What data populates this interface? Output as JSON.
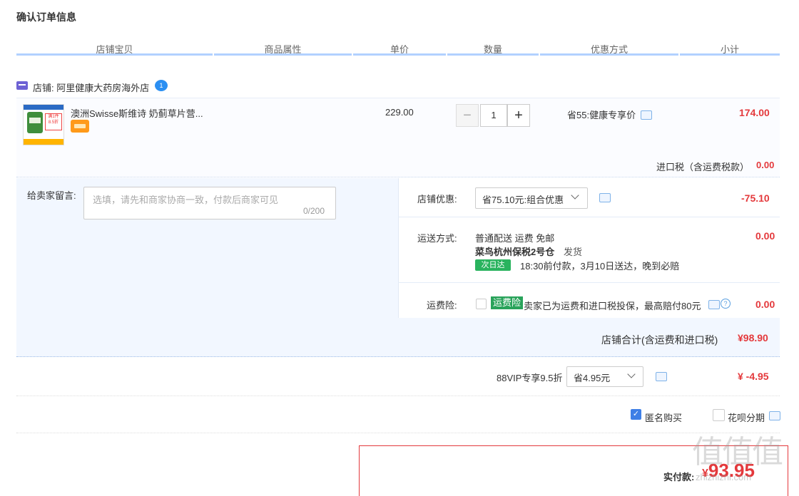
{
  "page_title": "确认订单信息",
  "headers": [
    "店铺宝贝",
    "商品属性",
    "单价",
    "数量",
    "优惠方式",
    "小计"
  ],
  "shop": {
    "label": "店铺: 阿里健康大药房海外店",
    "badge": "1"
  },
  "item": {
    "name": "澳洲Swisse斯维诗 奶蓟草片营...",
    "thumb_text_1": "满1件",
    "thumb_text_2": "8.5折",
    "price": "229.00",
    "qty_minus": "−",
    "quantity": "1",
    "qty_plus": "+",
    "promo": "省55:健康专享价",
    "subtotal": "174.00",
    "tax_label": "进口税（含运费税款）",
    "tax_value": "0.00"
  },
  "message": {
    "label": "给卖家留言:",
    "placeholder": "选填，请先和商家协商一致，付款后商家可见",
    "count": "0/200"
  },
  "shop_discount": {
    "label": "店铺优惠:",
    "selected": "省75.10元:组合优惠",
    "value": "-75.10"
  },
  "shipping": {
    "label": "运送方式:",
    "line1": "普通配送 运费 免邮",
    "warehouse": "菜鸟杭州保税2号仓",
    "ship_text": "发货",
    "tag": "次日达",
    "promise": "18:30前付款，3月10日送达，晚到必赔",
    "value": "0.00"
  },
  "insurance": {
    "label": "运费险:",
    "badge": "运费险",
    "text": "卖家已为运费和进口税投保，最高赔付80元",
    "value": "0.00"
  },
  "shop_total": {
    "label": "店铺合计(含运费和进口税)",
    "value": "¥98.90"
  },
  "vip": {
    "label": "88VIP专享9.5折",
    "selected": "省4.95元",
    "value": "¥ -4.95"
  },
  "options": {
    "anonymous": "匿名购买",
    "anonymous_checked": true,
    "huabei": "花呗分期",
    "huabei_checked": false
  },
  "payment": {
    "label": "实付款:",
    "currency": "¥",
    "value": "93.95"
  },
  "watermark": {
    "main": "值值值",
    "sub": "zhizhizhi.com"
  },
  "colors": {
    "accent_red": "#e4393c",
    "header_line": "#b2d1ff",
    "panel_bg": "#f2f7ff",
    "check_blue": "#3e7fe6",
    "green": "#29b35e"
  }
}
